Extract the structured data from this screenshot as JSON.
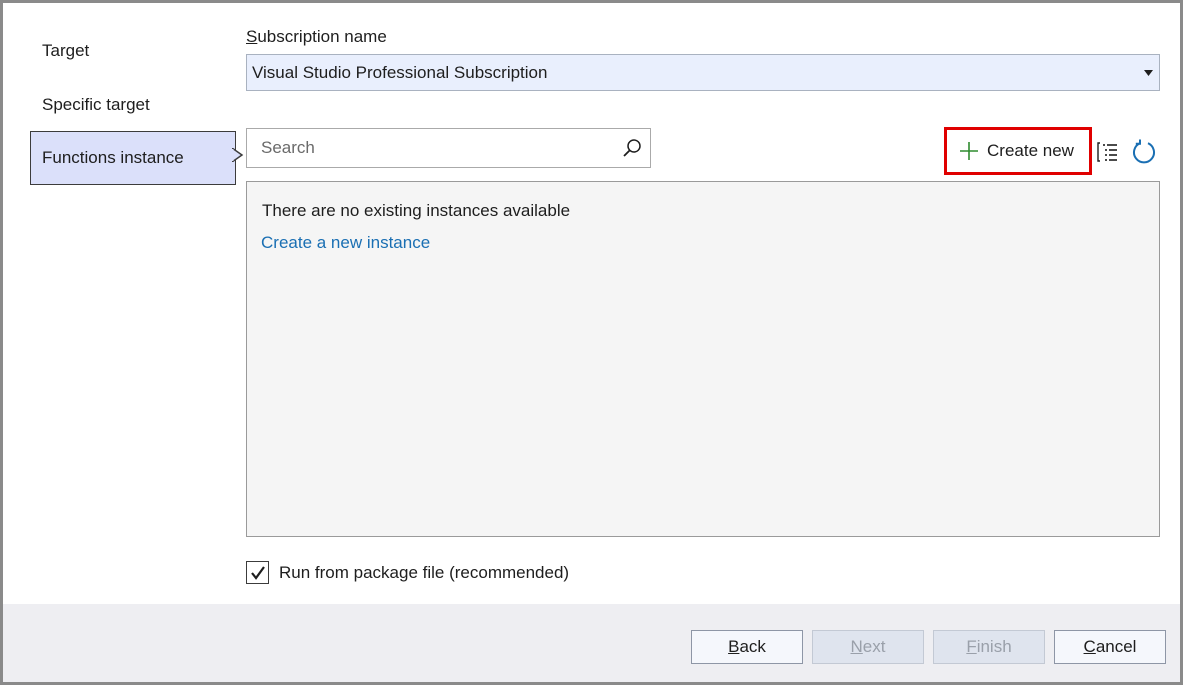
{
  "sidebar": {
    "items": [
      {
        "label": "Target"
      },
      {
        "label": "Specific target"
      },
      {
        "label": "Functions instance",
        "active": true
      }
    ]
  },
  "subscription": {
    "label_first": "S",
    "label_rest": "ubscription name",
    "value": "Visual Studio Professional Subscription"
  },
  "search": {
    "placeholder": "Search"
  },
  "toolbar": {
    "create_new_label": "Create new",
    "list_icon": "list-view-icon",
    "refresh_icon": "refresh-icon"
  },
  "instances": {
    "empty_message": "There are no existing instances available",
    "create_link": "Create a new instance"
  },
  "options": {
    "run_from_package_label": "Run from package file (recommended)",
    "run_from_package_checked": true
  },
  "footer": {
    "back": {
      "first": "B",
      "rest": "ack"
    },
    "next": {
      "first": "N",
      "rest": "ext"
    },
    "finish": {
      "first": "F",
      "rest": "inish"
    },
    "cancel": {
      "first": "C",
      "rest": "ancel"
    }
  },
  "colors": {
    "accent_highlight": "#e00000",
    "active_nav_bg": "#dbe0fa",
    "link": "#1a6fb3",
    "plus_green": "#2e8b2e",
    "refresh_blue": "#1a6fb3"
  }
}
